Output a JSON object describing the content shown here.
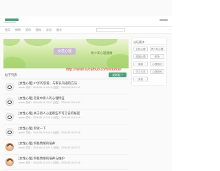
{
  "nav": {
    "items": [
      "首页",
      "新闻",
      "资讯",
      "图库",
      "论坛",
      "留言"
    ]
  },
  "banner": {
    "title": "女性心理",
    "subtitle": "青少年心理健康"
  },
  "watermark": "http://www.sucaihuo.com/source/",
  "posts_section": {
    "title": "帖子列表",
    "new_post_label": "发新帖 +",
    "posts": [
      {
        "title": "[女性心理] 17岁的恋爱，与家长沟通的方法",
        "meta": "admin 发布：2016-08-16 10:21 | 回复：2016-08-16 10:21"
      },
      {
        "title": "[女性心理] 恋爱中男人的心理特征",
        "meta": "admin 发布：2016-08-16 10:20 | 回复：2016-08-16 10:20"
      },
      {
        "title": "[女性心理] 关于男人心里那些不可言说的秘密",
        "meta": "admin 发布：2016-08-16 10:19 | 回复：2016-08-16 10:19"
      },
      {
        "title": "[女性心理] 测试一下",
        "meta": "admin 发布：2016-08-16 10:18 | 回复：2016-08-16 10:18"
      },
      {
        "title": "[女性心理] 积极情绪的培养",
        "meta": "admin 发布：2016-08-16 10:17 | 回复：2016-08-16 10:17"
      },
      {
        "title": "[女性心理] 积极情绪的培养与维护",
        "meta": "admin 发布：2016-08-16 10:16 | 回复：2016-08-16 10:16"
      }
    ]
  },
  "sidebar": {
    "title": "论坛版块",
    "tags": [
      "女性心理",
      "青少年心理",
      "婚姻心理",
      "职场",
      "情感",
      "心理测试",
      "学习方法",
      "心理咨询",
      "其他"
    ]
  },
  "colors": {
    "accent": "#4aa37a",
    "watermark": "#e02020",
    "banner_title_bg": "#c9b8d6"
  }
}
